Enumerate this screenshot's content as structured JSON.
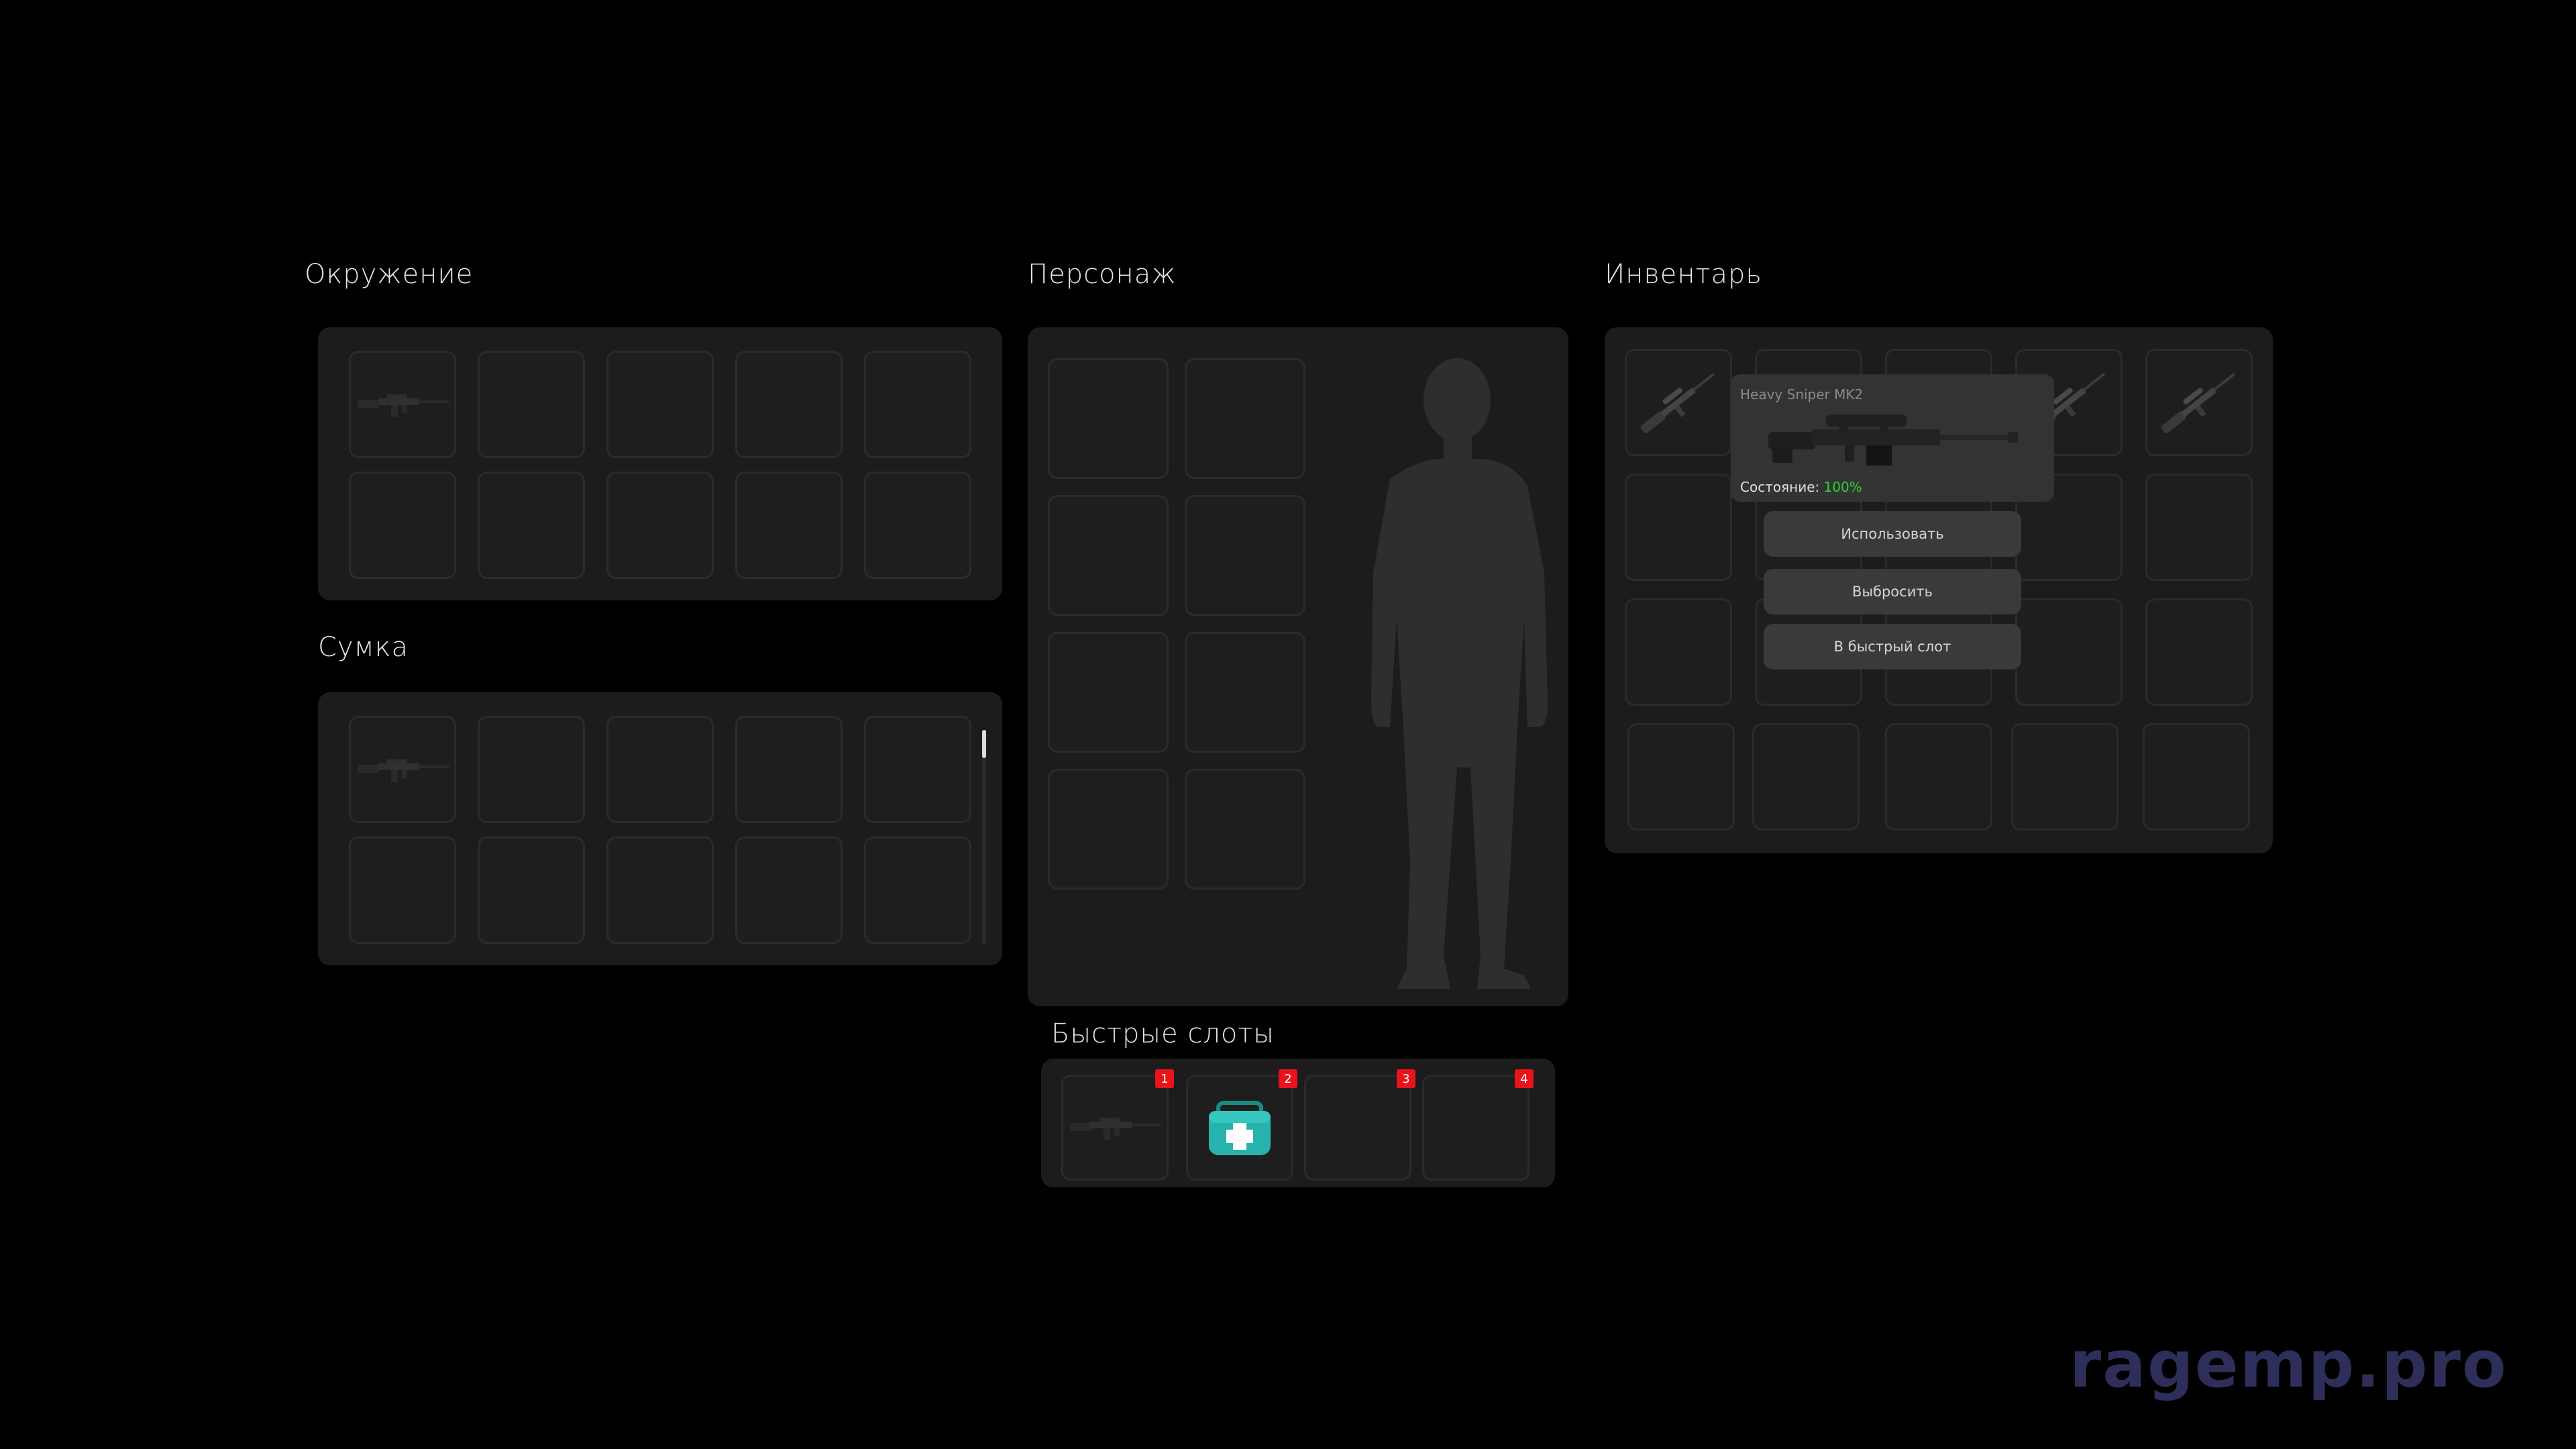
{
  "sections": {
    "surroundings": "Окружение",
    "bag": "Сумка",
    "character": "Персонаж",
    "inventory": "Инвентарь",
    "quick_slots": "Быстрые слоты"
  },
  "tooltip": {
    "item_name": "Heavy Sniper MK2",
    "condition_label": "Состояние:",
    "condition_value": "100%"
  },
  "context_menu": {
    "use": "Использовать",
    "drop": "Выбросить",
    "to_quick_slot": "В быстрый слот"
  },
  "quick_slot_numbers": [
    "1",
    "2",
    "3",
    "4"
  ],
  "watermark": "ragemp.pro",
  "colors": {
    "accent_green": "#2fd13a",
    "badge_red": "#e8131b"
  }
}
